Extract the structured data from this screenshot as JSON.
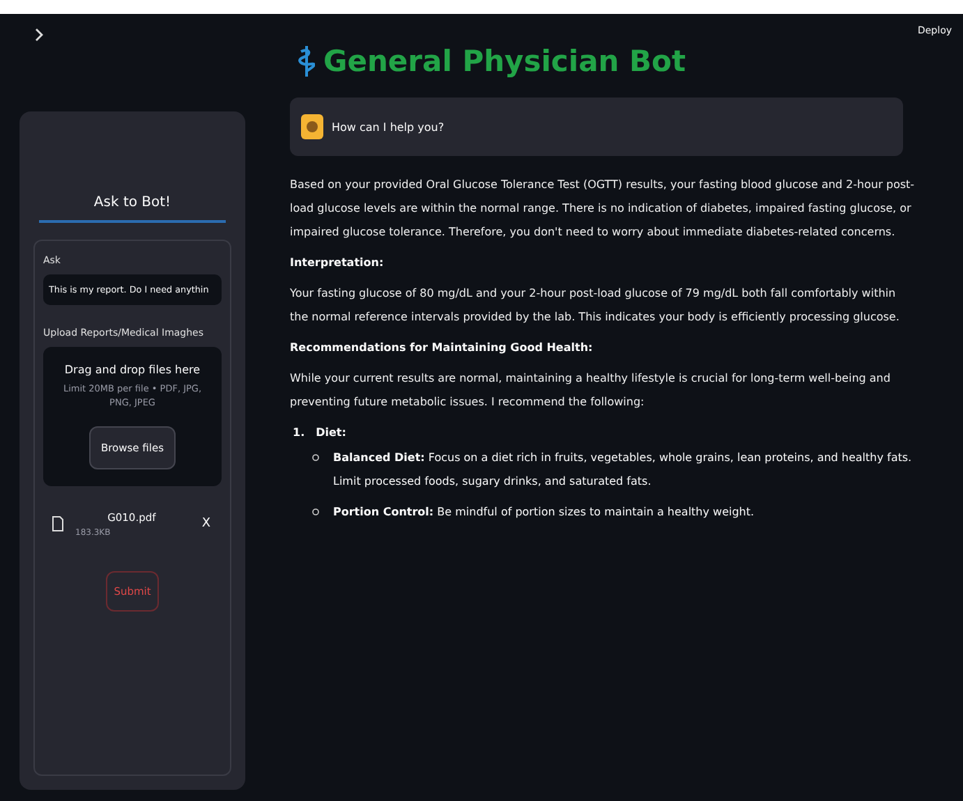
{
  "header": {
    "deploy": "Deploy"
  },
  "sidebar": {
    "form": {
      "title": "Ask to Bot!",
      "ask_label": "Ask",
      "ask_value": "This is my report. Do I need anythin",
      "upload_label": "Upload Reports/Medical Imaghes",
      "dropzone": {
        "title": "Drag and drop files here",
        "hint": "Limit 20MB per file • PDF, JPG, PNG, JPEG",
        "button": "Browse files"
      },
      "files": [
        {
          "name": "G010.pdf",
          "size": "183.3KB",
          "remove": "X"
        }
      ],
      "submit": "Submit"
    }
  },
  "main": {
    "title": "General Physician Bot",
    "greeting": "How can I help you?",
    "response": [
      {
        "kind": "paragraph",
        "text": "Based on your provided Oral Glucose Tolerance Test (OGTT) results, your fasting blood glucose and 2-hour post-load glucose levels are within the normal range. There is no indication of diabetes, impaired fasting glucose, or impaired glucose tolerance. Therefore, you don't need to worry about immediate diabetes-related concerns."
      },
      {
        "kind": "heading",
        "text": "Interpretation:"
      },
      {
        "kind": "paragraph",
        "text": "Your fasting glucose of 80 mg/dL and your 2-hour post-load glucose of 79 mg/dL both fall comfortably within the normal reference intervals provided by the lab. This indicates your body is efficiently processing glucose."
      },
      {
        "kind": "heading",
        "text": "Recommendations for Maintaining Good Health:"
      },
      {
        "kind": "paragraph",
        "text": "While your current results are normal, maintaining a healthy lifestyle is crucial for long-term well-being and preventing future metabolic issues. I recommend the following:"
      },
      {
        "kind": "numbered",
        "number": "1.",
        "text": "Diet:"
      },
      {
        "kind": "bullet",
        "text": "**Balanced Diet:** Focus on a diet rich in fruits, vegetables, whole grains, lean proteins, and healthy fats. Limit processed foods, sugary drinks, and saturated fats."
      },
      {
        "kind": "bullet",
        "text": "**Portion Control:** Be mindful of portion sizes to maintain a healthy weight."
      }
    ]
  }
}
